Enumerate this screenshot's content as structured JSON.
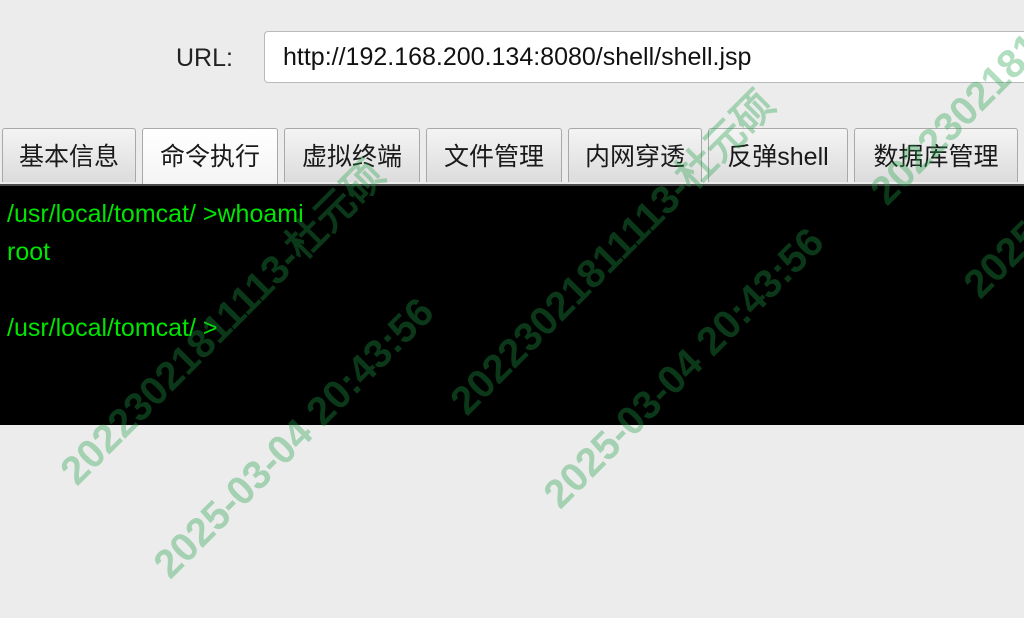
{
  "url_bar": {
    "label": "URL:",
    "value": "http://192.168.200.134:8080/shell/shell.jsp"
  },
  "tabs": [
    {
      "label": "基本信息",
      "active": false
    },
    {
      "label": "命令执行",
      "active": true
    },
    {
      "label": "虚拟终端",
      "active": false
    },
    {
      "label": "文件管理",
      "active": false
    },
    {
      "label": "内网穿透",
      "active": false
    },
    {
      "label": "反弹shell",
      "active": false
    },
    {
      "label": "数据库管理",
      "active": false
    }
  ],
  "terminal": {
    "lines": [
      "/usr/local/tomcat/ >whoami",
      "root",
      "",
      "/usr/local/tomcat/ >"
    ],
    "text_color": "#00e600",
    "background": "#000000"
  },
  "watermark": {
    "line1": "20223021811113-杜元硕",
    "line2": "2025-03-04 20:43:56"
  }
}
